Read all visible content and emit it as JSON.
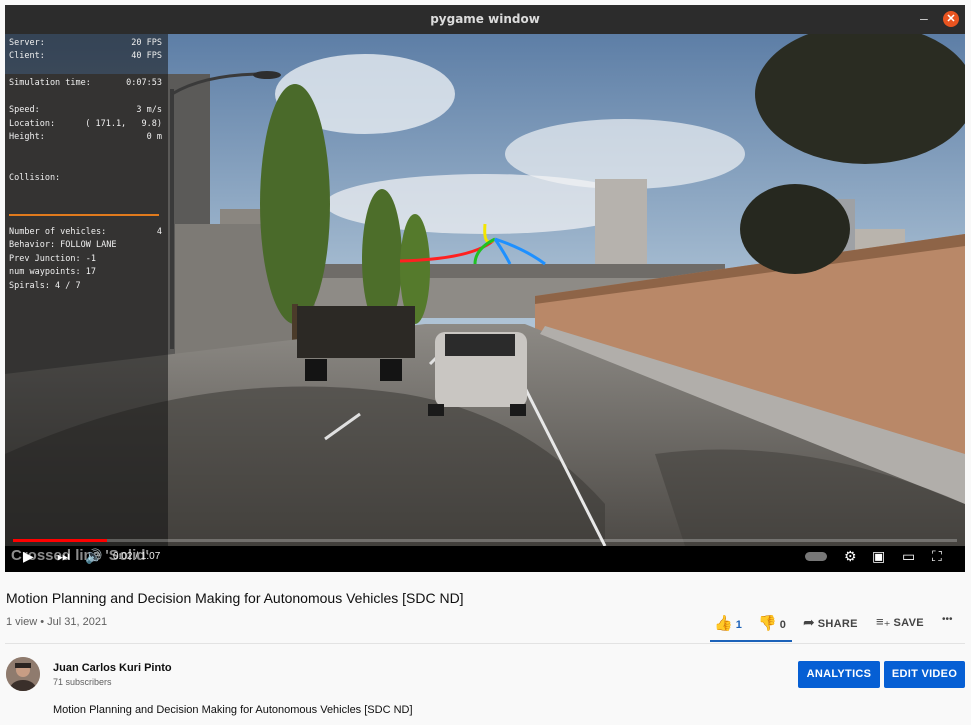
{
  "window": {
    "title": "pygame window",
    "minimize": "–",
    "close": "✕"
  },
  "hud": {
    "rows": [
      {
        "label": "Server:",
        "value": "20 FPS"
      },
      {
        "label": "Client:",
        "value": "40 FPS"
      },
      {
        "label": "Simulation time:",
        "value": "0:07:53"
      },
      {
        "label": "Speed:",
        "value": "3 m/s"
      },
      {
        "label": "Location:",
        "value": "( 171.1,   9.8)"
      },
      {
        "label": "Height:",
        "value": "0 m"
      },
      {
        "label": "Collision:",
        "value": ""
      },
      {
        "label": "Number of vehicles:",
        "value": "4"
      },
      {
        "label": "Behavior: FOLLOW LANE",
        "value": ""
      },
      {
        "label": "Prev Junction: -1",
        "value": ""
      },
      {
        "label": "num waypoints: 17",
        "value": ""
      },
      {
        "label": "Spirals: 4 / 7",
        "value": ""
      }
    ],
    "accent": "#e07a1d"
  },
  "player": {
    "caption": "Crossed line 'Solid'",
    "time": "0:02 / 1:07",
    "progress": 0.1,
    "icons": [
      "play-icon",
      "next-icon",
      "volume-icon",
      "autoplay-toggle",
      "settings-icon",
      "miniplayer-icon",
      "theater-icon",
      "fullscreen-icon"
    ]
  },
  "video": {
    "title": "Motion Planning and Decision Making for Autonomous Vehicles [SDC ND]",
    "meta": "1 view • Jul 31, 2021",
    "likes": "1",
    "dislikes": "0",
    "share": "SHARE",
    "save": "SAVE",
    "more": "•••"
  },
  "channel": {
    "name": "Juan Carlos Kuri Pinto",
    "subscribers": "71 subscribers",
    "analytics": "ANALYTICS",
    "edit": "EDIT VIDEO",
    "description": "Motion Planning and Decision Making for Autonomous Vehicles [SDC ND]"
  },
  "colors": {
    "accent_blue": "#065fd4",
    "progress_red": "#ff0000"
  }
}
